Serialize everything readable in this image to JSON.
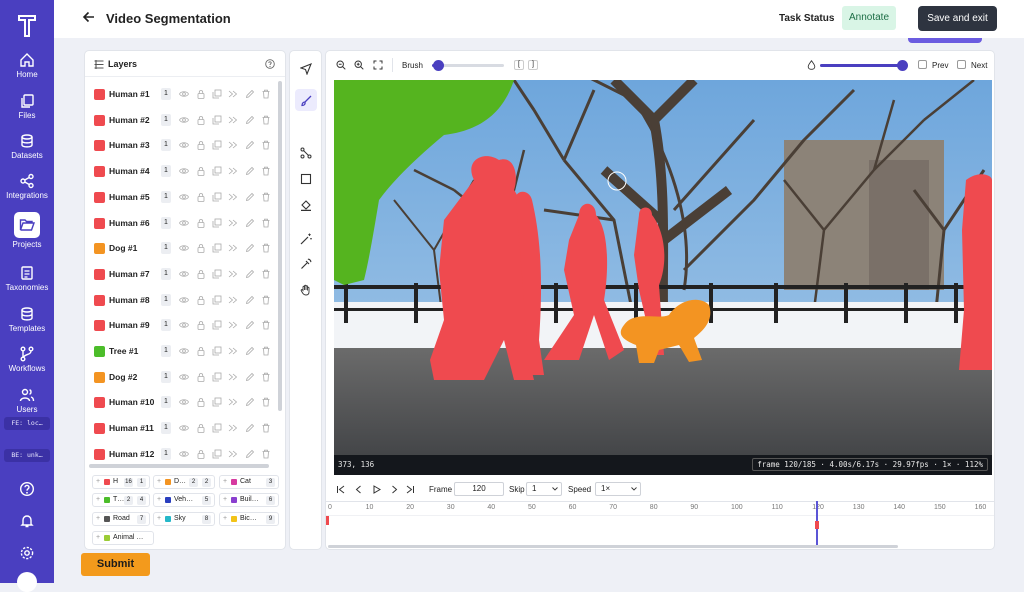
{
  "nav": {
    "items": [
      {
        "label": "Home",
        "icon": "home-icon"
      },
      {
        "label": "Files",
        "icon": "files-icon"
      },
      {
        "label": "Datasets",
        "icon": "database-icon"
      },
      {
        "label": "Integrations",
        "icon": "share-icon"
      },
      {
        "label": "Projects",
        "icon": "folder-open-icon"
      },
      {
        "label": "Taxonomies",
        "icon": "list-icon"
      },
      {
        "label": "Templates",
        "icon": "template-icon"
      },
      {
        "label": "Workflows",
        "icon": "workflow-icon"
      },
      {
        "label": "Users",
        "icon": "users-icon"
      }
    ],
    "fe_env": "FE: loc…",
    "be_env": "BE: unk…",
    "active": "Projects"
  },
  "header": {
    "title": "Video Segmentation",
    "task_status_label": "Task Status",
    "status_value": "Annotate",
    "save_label": "Save and exit"
  },
  "layers": {
    "title": "Layers",
    "items": [
      {
        "name": "Human #1",
        "count": "1",
        "color": "#ef4a4f"
      },
      {
        "name": "Human #2",
        "count": "1",
        "color": "#ef4a4f"
      },
      {
        "name": "Human #3",
        "count": "1",
        "color": "#ef4a4f"
      },
      {
        "name": "Human #4",
        "count": "1",
        "color": "#ef4a4f"
      },
      {
        "name": "Human #5",
        "count": "1",
        "color": "#ef4a4f"
      },
      {
        "name": "Human #6",
        "count": "1",
        "color": "#ef4a4f"
      },
      {
        "name": "Dog #1",
        "count": "1",
        "color": "#f39422"
      },
      {
        "name": "Human #7",
        "count": "1",
        "color": "#ef4a4f"
      },
      {
        "name": "Human #8",
        "count": "1",
        "color": "#ef4a4f"
      },
      {
        "name": "Human #9",
        "count": "1",
        "color": "#ef4a4f"
      },
      {
        "name": "Tree #1",
        "count": "1",
        "color": "#4cbd2a"
      },
      {
        "name": "Dog #2",
        "count": "1",
        "color": "#f39422"
      },
      {
        "name": "Human #10",
        "count": "1",
        "color": "#ef4a4f"
      },
      {
        "name": "Human #11",
        "count": "1",
        "color": "#ef4a4f"
      },
      {
        "name": "Human #12",
        "count": "1",
        "color": "#ef4a4f"
      }
    ],
    "classes": [
      {
        "name": "H",
        "count": "16",
        "sub": "1",
        "color": "#ef4a4f"
      },
      {
        "name": "D…",
        "count": "2",
        "sub": "2",
        "color": "#f39422"
      },
      {
        "name": "Cat",
        "count": "3",
        "color": "#d63aa0"
      },
      {
        "name": "T…",
        "count": "2",
        "sub": "4",
        "color": "#4cbd2a"
      },
      {
        "name": "Veh…",
        "count": "5",
        "color": "#2a3fbf"
      },
      {
        "name": "Buil…",
        "count": "6",
        "color": "#8a3fcf"
      },
      {
        "name": "Road",
        "count": "7",
        "color": "#555555"
      },
      {
        "name": "Sky",
        "count": "8",
        "color": "#25b8c9"
      },
      {
        "name": "Bic…",
        "count": "9",
        "color": "#f2c318"
      },
      {
        "name": "Animal …",
        "count": "",
        "color": "#9bcc35"
      }
    ]
  },
  "toolbar": {
    "brush_label": "Brush",
    "brush_level": 0.08,
    "opacity_level": 0.95,
    "prev_label": "Prev",
    "next_label": "Next"
  },
  "canvas": {
    "cursor_coords": "373, 136",
    "frame_info": "frame 120/185 · 4.00s/6.17s · 29.97fps · 1× · 112%"
  },
  "playback": {
    "frame_label": "Frame",
    "frame_value": "120",
    "skip_label": "Skip",
    "skip_value": "1",
    "speed_label": "Speed",
    "speed_value": "1×",
    "timeline_ticks": [
      "0",
      "10",
      "20",
      "30",
      "40",
      "50",
      "60",
      "70",
      "80",
      "90",
      "100",
      "110",
      "120",
      "130",
      "140",
      "150",
      "160"
    ],
    "current_frame": 120,
    "total_frames": 185
  },
  "submit_label": "Submit",
  "colors": {
    "nav": "#4a3fc0",
    "accent": "#6b5ce0",
    "submit": "#f39a1c"
  }
}
